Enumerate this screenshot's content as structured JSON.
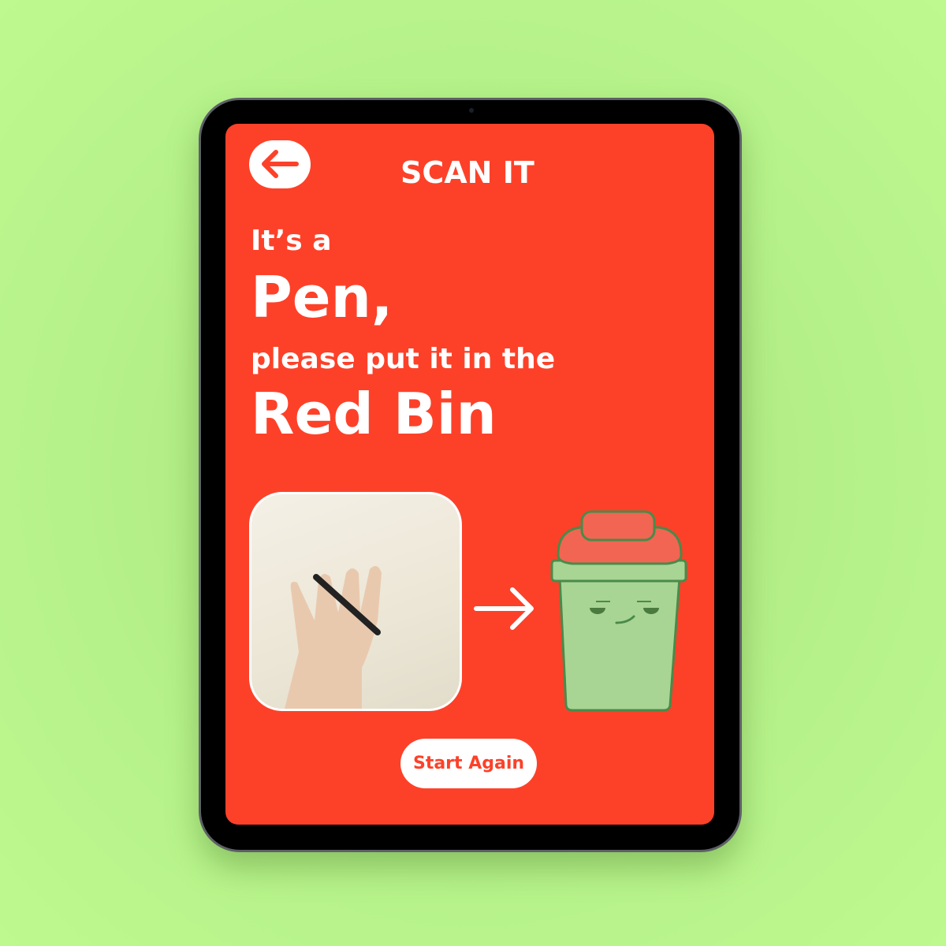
{
  "header": {
    "title": "SCAN IT",
    "back_icon": "arrow-left-icon"
  },
  "result": {
    "intro": "It’s a",
    "item": "Pen,",
    "instruction": "please put it in the",
    "bin": "Red Bin"
  },
  "illustration": {
    "photo": "hand holding pen",
    "arrow_icon": "arrow-right-icon",
    "bin_icon": "smiling-green-bin-with-red-lid-icon"
  },
  "actions": {
    "start_again": "Start Again"
  },
  "colors": {
    "background": "#bdf98e",
    "screen": "#fd4129",
    "bin_body": "#a8d594",
    "bin_lid": "#f26552",
    "bin_outline": "#4a8a4a"
  }
}
